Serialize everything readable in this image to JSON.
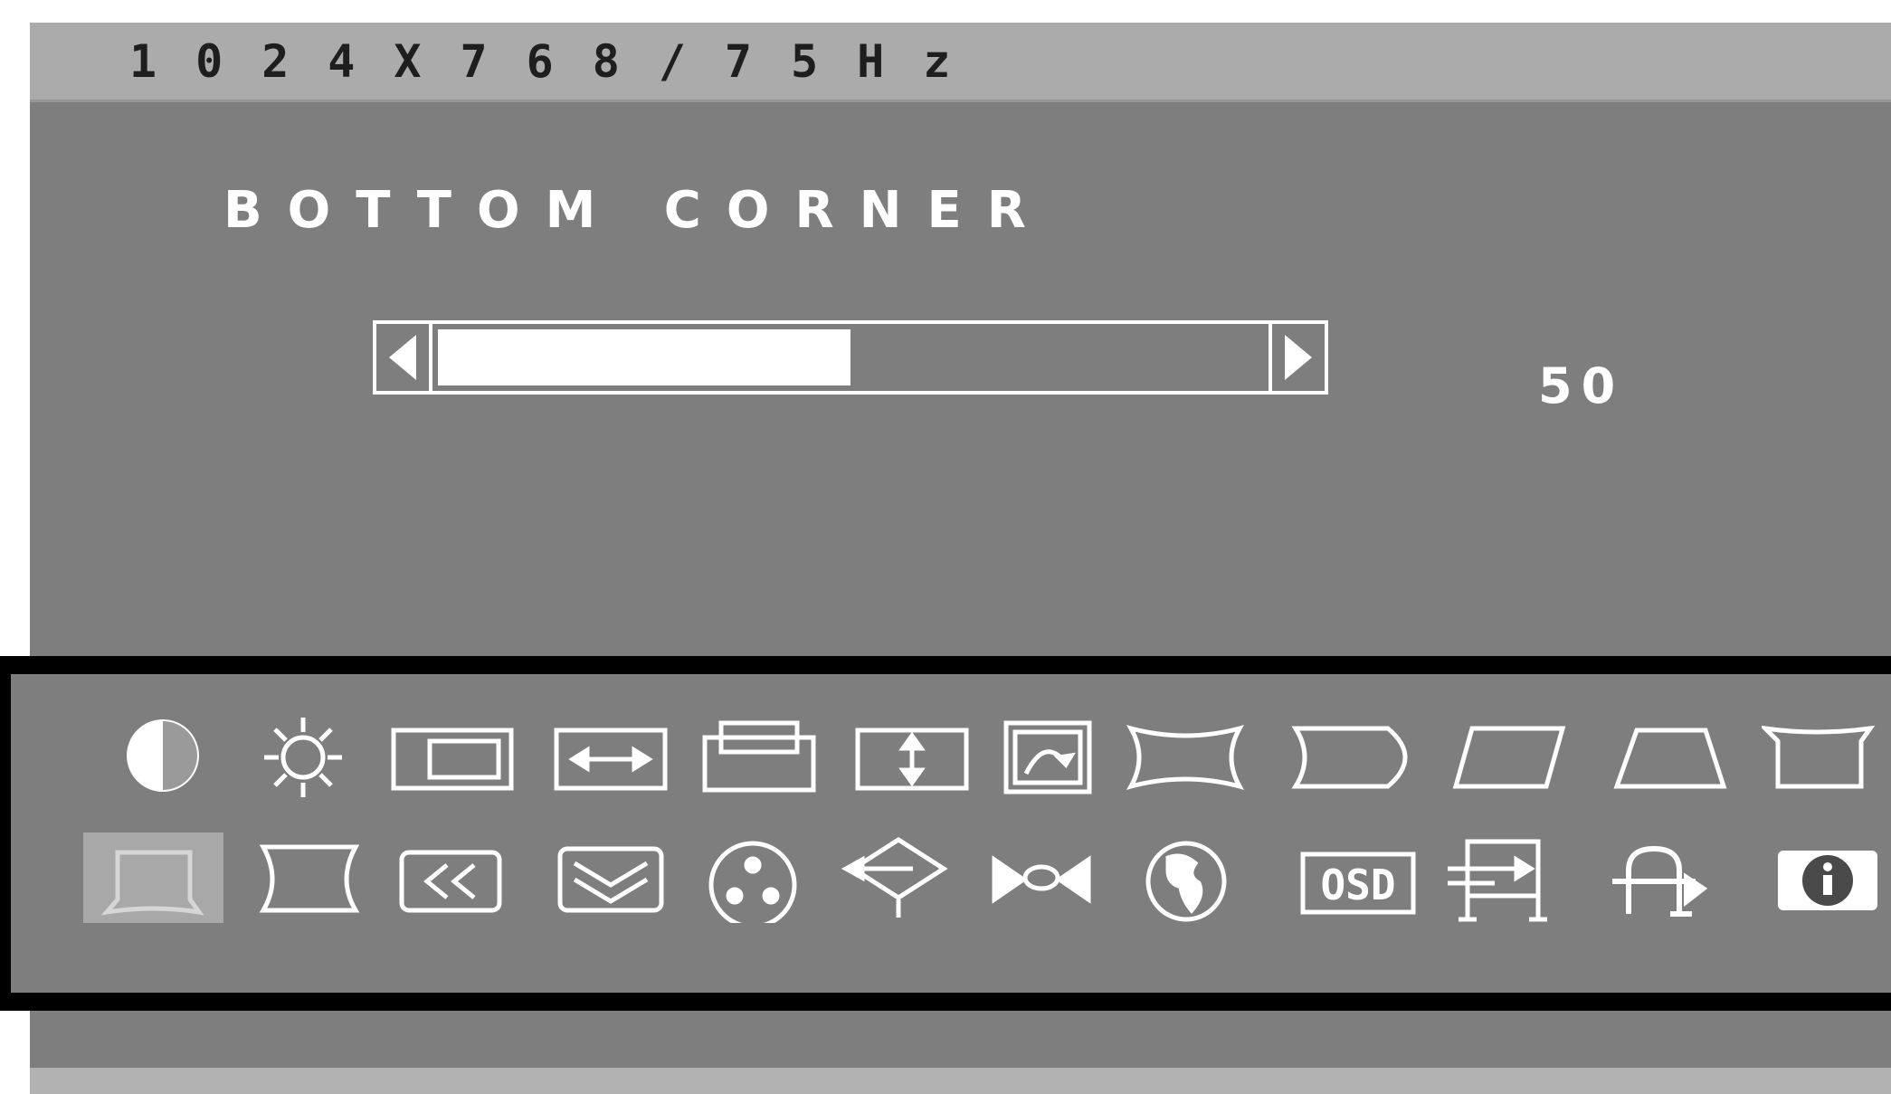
{
  "header": {
    "resolution": "1024X768/75Hz"
  },
  "menu": {
    "title": "BOTTOM CORNER"
  },
  "slider": {
    "value": "50",
    "level_percent": 50
  },
  "colors": {
    "panel": "#7e7e7e",
    "header": "#ababab",
    "foreground": "#ffffff",
    "frame": "#000000"
  },
  "icon_rows": [
    [
      "contrast-icon",
      "brightness-icon",
      "h-size-icon",
      "h-position-icon",
      "v-size-icon",
      "v-position-icon",
      "tilt-icon",
      "pincushion-icon",
      "pin-balance-icon",
      "parallelogram-icon",
      "trapezoid-icon",
      "top-corner-icon"
    ],
    [
      "bottom-corner-icon",
      "side-pincushion-icon",
      "moire-icon",
      "v-moire-icon",
      "color-icon",
      "input-icon",
      "sharpness-icon",
      "language-icon",
      "osd-icon",
      "osd-position-icon",
      "reset-icon",
      "information-icon"
    ]
  ],
  "selected_icon": "bottom-corner-icon"
}
